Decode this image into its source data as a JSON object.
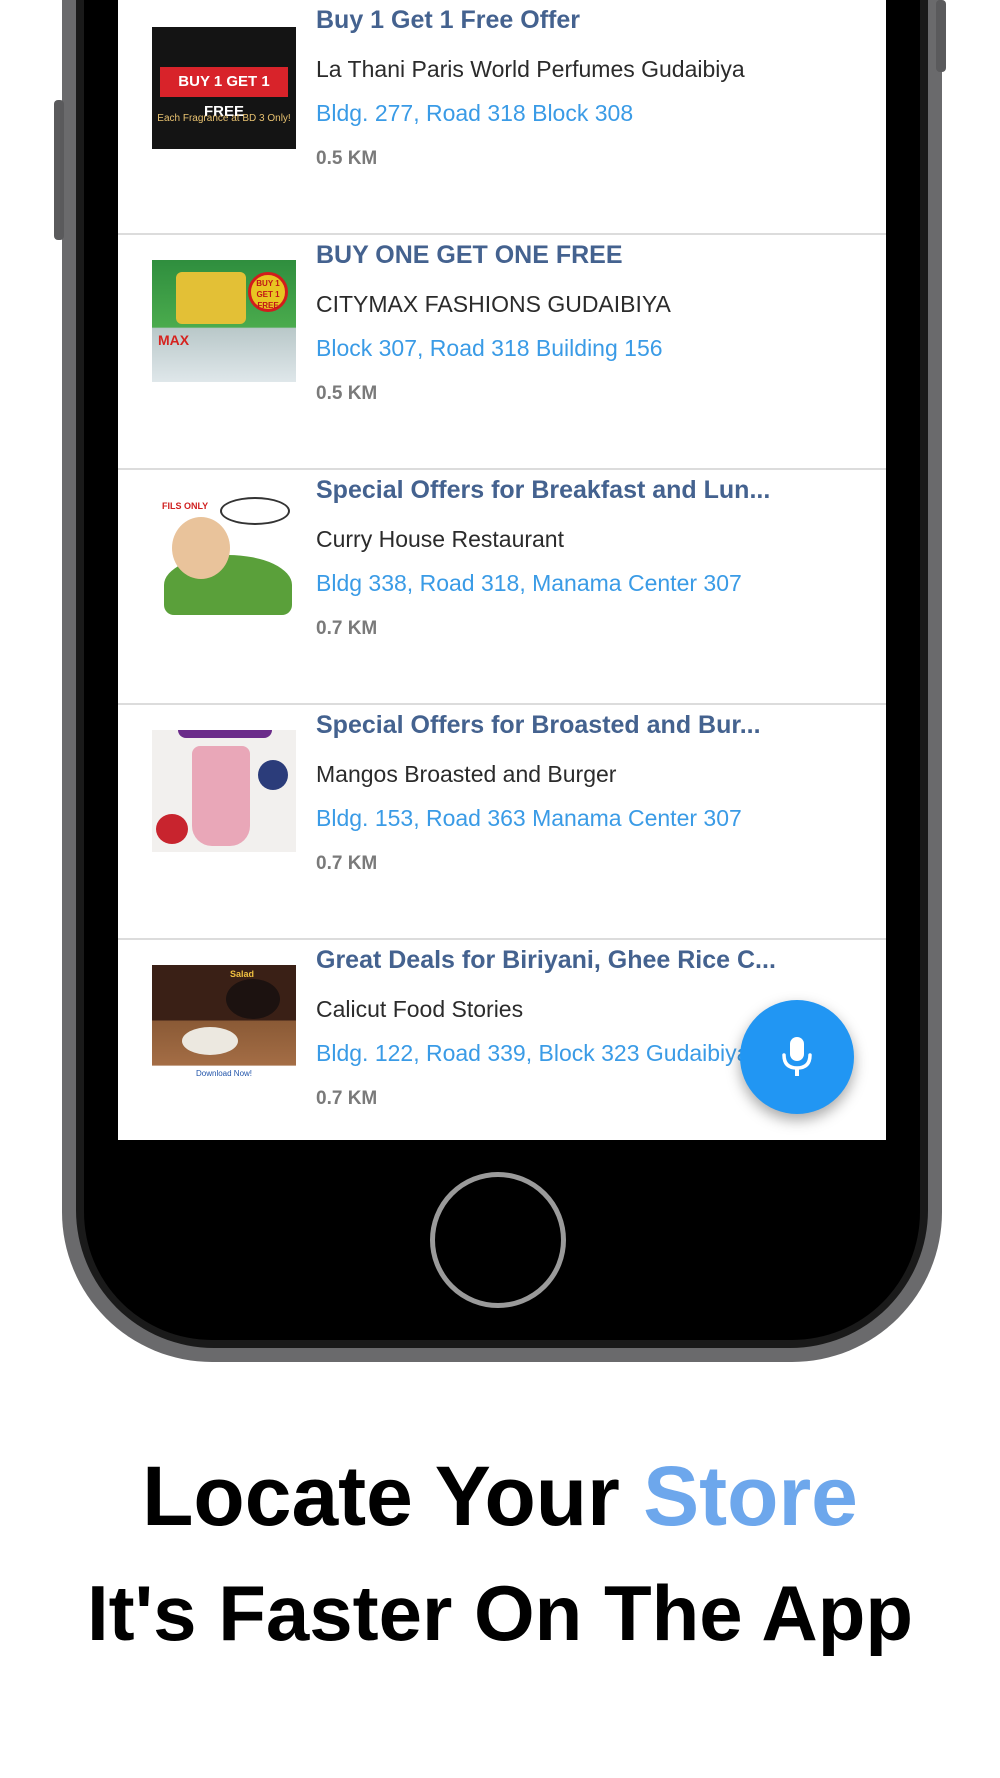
{
  "offers": [
    {
      "title": "Buy 1 Get 1 Free Offer",
      "store": "La Thani Paris World Perfumes Gudaibiya",
      "address": "Bldg. 277, Road 318 Block 308",
      "distance": "0.5 KM",
      "thumb": {
        "banner": "BUY 1 GET 1 FREE",
        "caption": "Each Fragrance at BD 3 Only!"
      }
    },
    {
      "title": "BUY ONE GET ONE FREE",
      "store": "CITYMAX FASHIONS GUDAIBIYA",
      "address": "Block 307, Road 318 Building 156",
      "distance": "0.5 KM",
      "thumb": {
        "badge_top": "BUY 1",
        "badge_mid": "GET 1",
        "badge_bot": "FREE",
        "brand": "MAX"
      }
    },
    {
      "title": "Special Offers for Breakfast and Lun...",
      "store": "Curry House Restaurant",
      "address": "Bldg 338, Road 318, Manama Center 307",
      "distance": "0.7 KM",
      "thumb": {
        "tag": "FILS ONLY"
      }
    },
    {
      "title": "Special Offers for Broasted and Bur...",
      "store": "Mangos Broasted and Burger",
      "address": "Bldg. 153, Road 363 Manama Center 307",
      "distance": "0.7 KM",
      "thumb": {}
    },
    {
      "title": "Great Deals for Biriyani, Ghee Rice C...",
      "store": "Calicut Food Stories",
      "address": "Bldg. 122, Road 339, Block 323 Gudaibiya",
      "distance": "0.7 KM",
      "thumb": {
        "top": "Salad",
        "bottom": "Download Now!"
      }
    }
  ],
  "fab": {
    "icon": "microphone-icon"
  },
  "footer": {
    "headline_prefix": "Locate Your ",
    "headline_accent": "Store",
    "subheadline": "It's Faster On The App"
  },
  "colors": {
    "title": "#44628f",
    "address": "#3a9be6",
    "fab": "#2196f3",
    "accent": "#6da7ec"
  }
}
